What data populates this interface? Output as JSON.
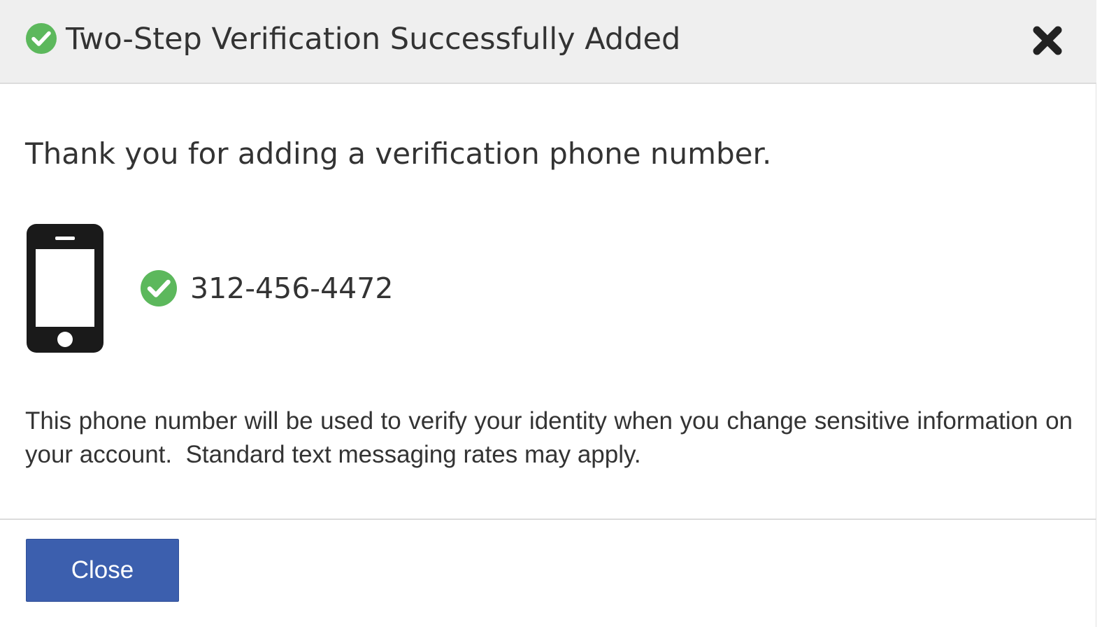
{
  "dialog": {
    "title": "Two-Step Verification Successfully Added",
    "title_icon": "check-circle-icon",
    "close_icon": "close-x-icon"
  },
  "body": {
    "thanks_text": "Thank you for adding a verification phone number.",
    "device_icon": "smartphone-icon",
    "status_icon": "check-circle-icon",
    "phone_number": "312-456-4472",
    "info_text": "This phone number will be used to verify your identity when you change sensitive information on your account.  Standard text messaging rates may apply."
  },
  "footer": {
    "close_label": "Close"
  },
  "colors": {
    "success_green": "#5cb85c",
    "primary_button": "#3c5fae",
    "header_background": "#efefef",
    "text": "#333333"
  }
}
